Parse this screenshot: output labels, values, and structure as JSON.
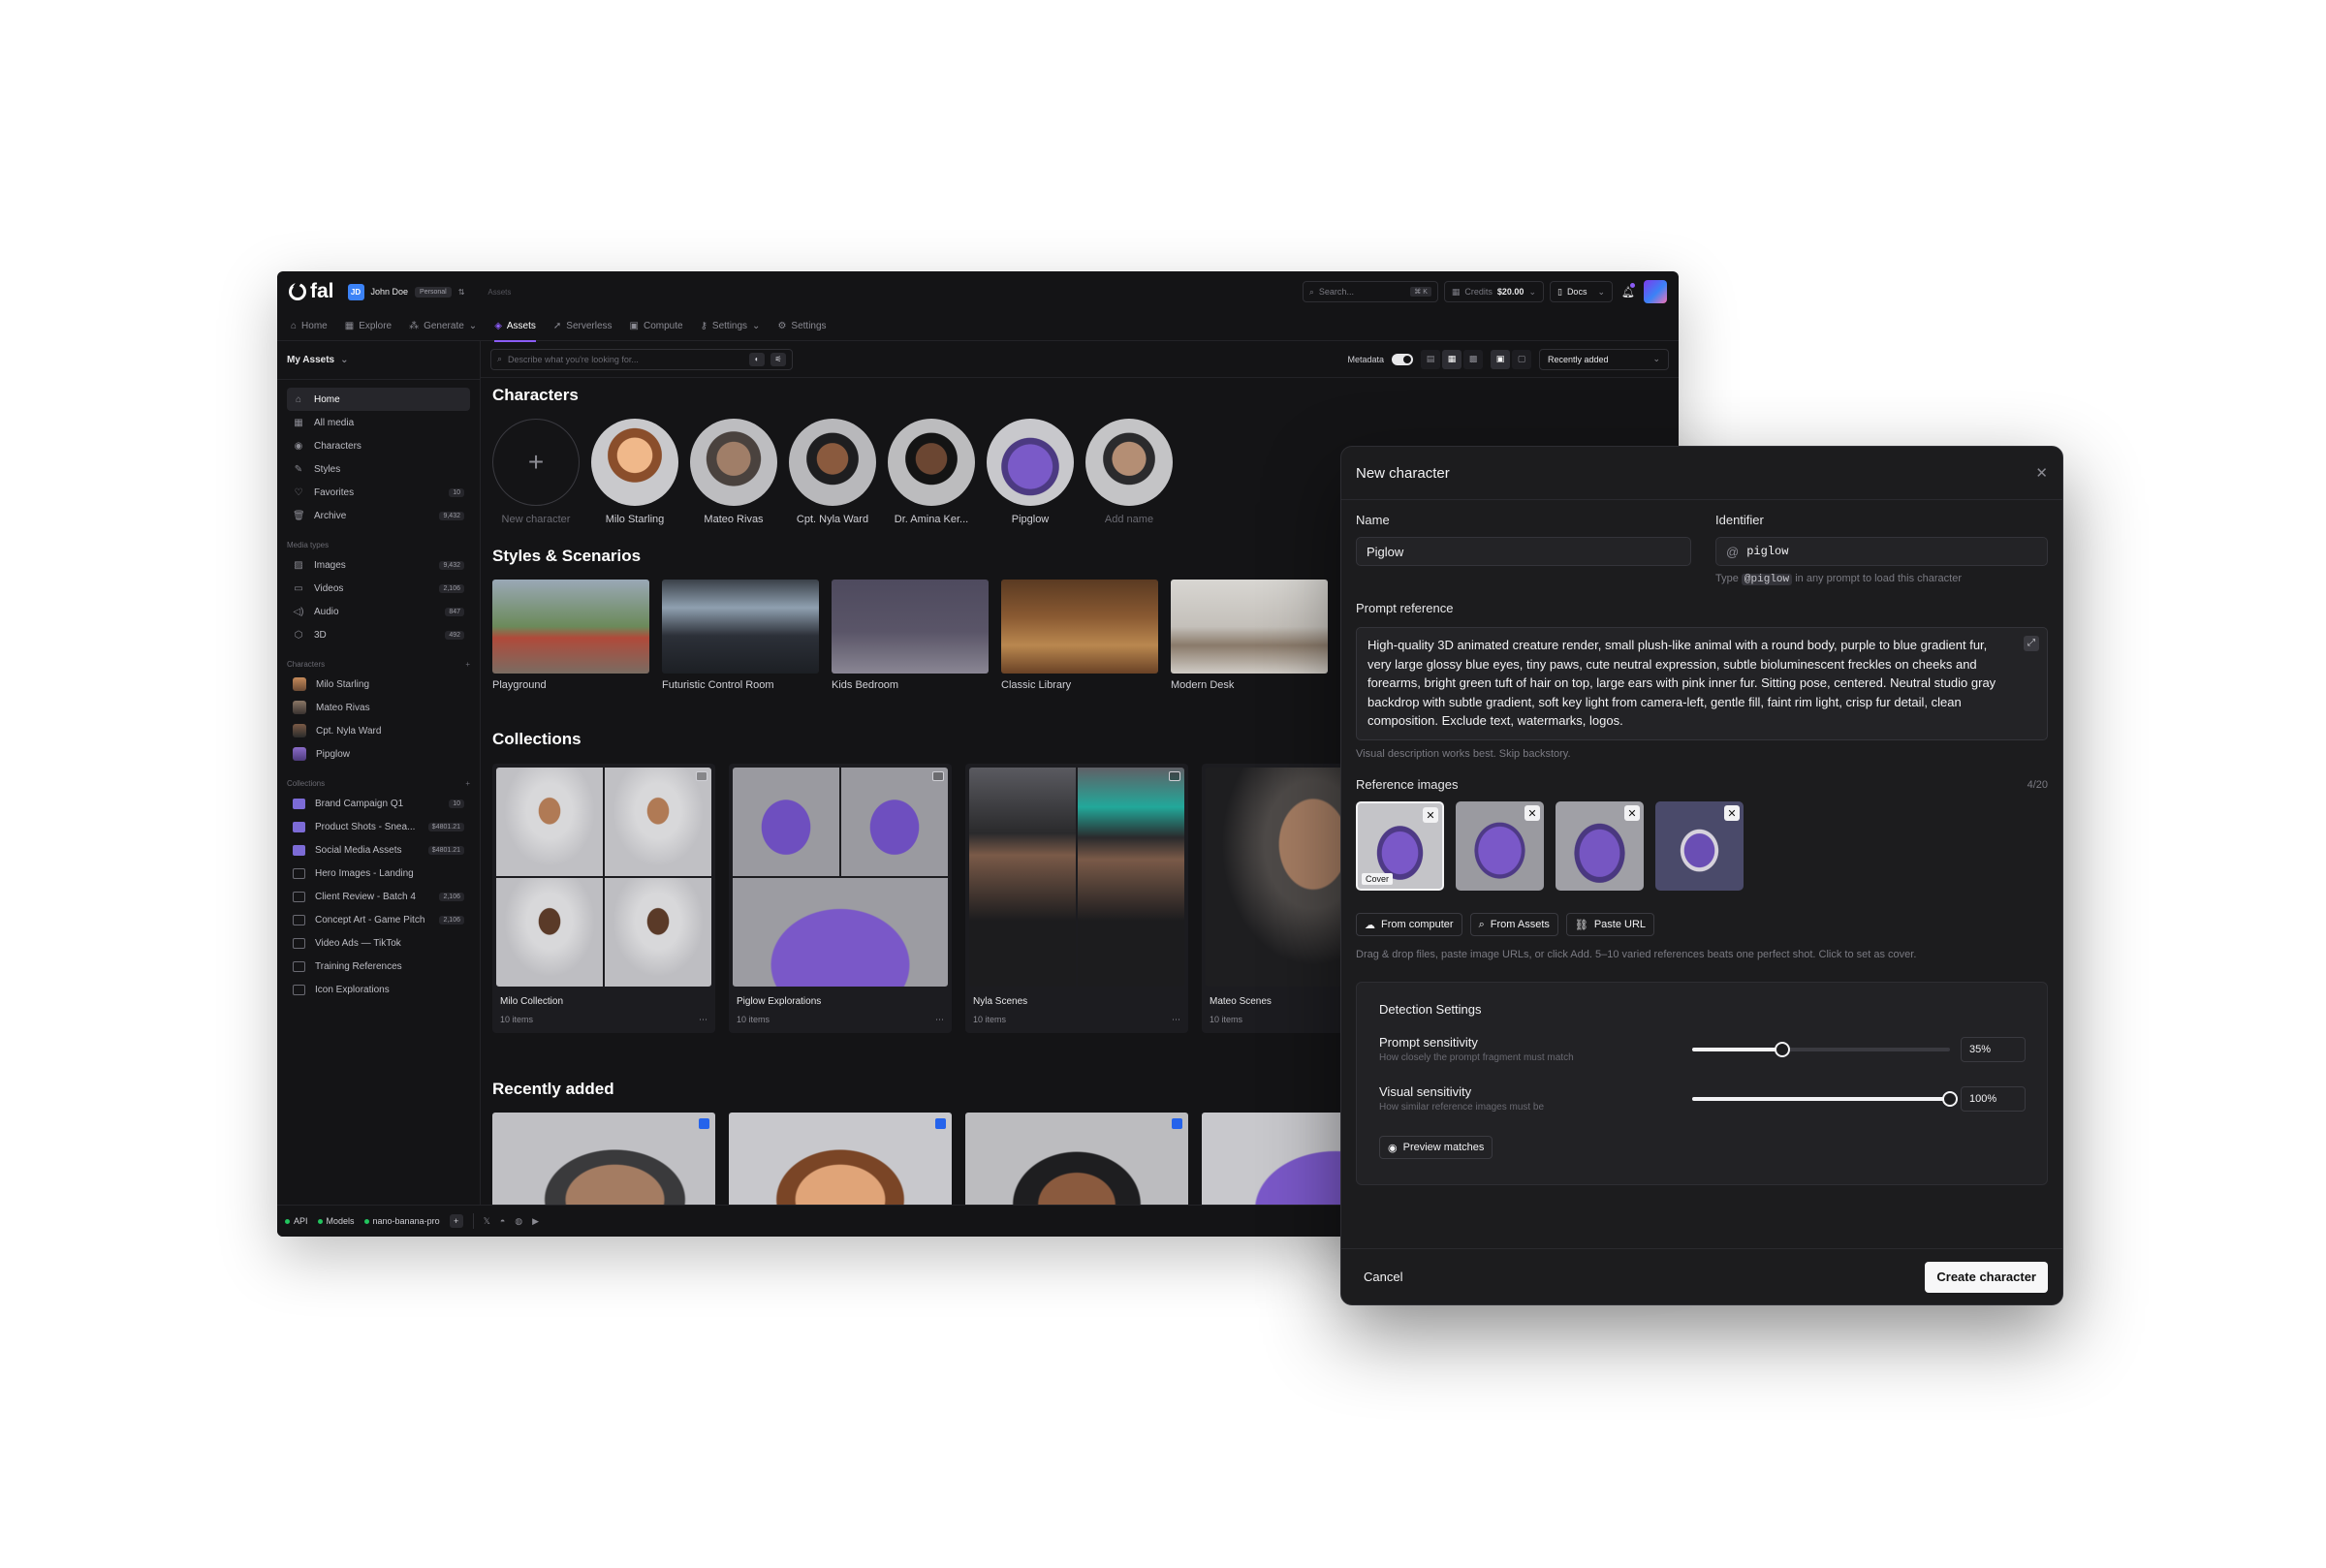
{
  "app": {
    "logo_text": "fal",
    "user": {
      "initials": "JD",
      "name": "John Doe",
      "plan": "Personal"
    },
    "breadcrumb": "Assets",
    "search": {
      "placeholder": "Search...",
      "shortcut": "⌘ K"
    },
    "credits": {
      "label": "Credits",
      "value": "$20.00"
    },
    "docs_label": "Docs",
    "colors": {
      "accent": "#8b5cf6",
      "background": "#141416",
      "badge_blue": "#2563eb"
    }
  },
  "nav": {
    "tabs": [
      {
        "label": "Home",
        "icon": "home-icon"
      },
      {
        "label": "Explore",
        "icon": "grid-icon"
      },
      {
        "label": "Generate",
        "icon": "sparkle-icon"
      },
      {
        "label": "Assets",
        "icon": "layers-icon",
        "active": true
      },
      {
        "label": "Serverless",
        "icon": "rocket-icon"
      },
      {
        "label": "Compute",
        "icon": "cpu-icon"
      },
      {
        "label": "Settings",
        "icon": "key-icon"
      },
      {
        "label": "Settings",
        "icon": "gear-icon"
      }
    ]
  },
  "sidebar": {
    "title": "My Assets",
    "items": [
      {
        "label": "Home",
        "active": true
      },
      {
        "label": "All media"
      },
      {
        "label": "Characters"
      },
      {
        "label": "Styles"
      },
      {
        "label": "Favorites",
        "count": "10"
      },
      {
        "label": "Archive",
        "count": "9,432"
      }
    ],
    "media_types_title": "Media types",
    "media_types": [
      {
        "label": "Images",
        "count": "9,432"
      },
      {
        "label": "Videos",
        "count": "2,106"
      },
      {
        "label": "Audio",
        "count": "847"
      },
      {
        "label": "3D",
        "count": "492"
      }
    ],
    "characters_title": "Characters",
    "characters": [
      {
        "label": "Milo Starling"
      },
      {
        "label": "Mateo Rivas"
      },
      {
        "label": "Cpt. Nyla Ward"
      },
      {
        "label": "Pipglow"
      }
    ],
    "collections_title": "Collections",
    "collections": [
      {
        "label": "Brand Campaign Q1",
        "count": "10"
      },
      {
        "label": "Product Shots - Snea...",
        "count": "$4801.21"
      },
      {
        "label": "Social Media Assets",
        "count": "$4801.21"
      },
      {
        "label": "Hero Images - Landing",
        "count": ""
      },
      {
        "label": "Client Review - Batch 4",
        "count": "2,106"
      },
      {
        "label": "Concept Art - Game Pitch",
        "count": "2,106"
      },
      {
        "label": "Video Ads — TikTok",
        "count": ""
      },
      {
        "label": "Training References",
        "count": ""
      },
      {
        "label": "Icon Explorations",
        "count": ""
      }
    ]
  },
  "toolbar": {
    "describe_placeholder": "Describe what you're looking for...",
    "metadata_label": "Metadata",
    "sort_label": "Recently added"
  },
  "main": {
    "characters_title": "Characters",
    "characters": [
      {
        "label": "New character"
      },
      {
        "label": "Milo Starling"
      },
      {
        "label": "Mateo Rivas"
      },
      {
        "label": "Cpt. Nyla Ward"
      },
      {
        "label": "Dr. Amina Ker..."
      },
      {
        "label": "Pipglow"
      },
      {
        "label": "Add name"
      }
    ],
    "styles_title": "Styles & Scenarios",
    "styles": [
      {
        "label": "Playground"
      },
      {
        "label": "Futuristic Control Room"
      },
      {
        "label": "Kids Bedroom"
      },
      {
        "label": "Classic Library"
      },
      {
        "label": "Modern Desk"
      }
    ],
    "collections_title": "Collections",
    "collections": [
      {
        "name": "Milo Collection",
        "count": "10 items"
      },
      {
        "name": "Piglow Explorations",
        "count": "10 items"
      },
      {
        "name": "Nyla Scenes",
        "count": "10 items"
      },
      {
        "name": "Mateo Scenes",
        "count": "10 items"
      }
    ],
    "recent_title": "Recently added"
  },
  "bottombar": {
    "api": "API",
    "models": "Models",
    "model_name": "nano-banana-pro"
  },
  "modal": {
    "title": "New character",
    "name_label": "Name",
    "name_value": "Piglow",
    "identifier_label": "Identifier",
    "identifier_prefix": "@",
    "identifier_value": "piglow",
    "identifier_hint_pre": "Type",
    "identifier_hint_code": "@piglow",
    "identifier_hint_post": "in any prompt to load this character",
    "prompt_label": "Prompt reference",
    "prompt_value": "High-quality 3D animated creature render, small plush-like animal with a round body, purple to blue gradient fur, very large glossy blue eyes, tiny paws, cute neutral expression, subtle bioluminescent freckles on cheeks and forearms, bright green tuft of hair on top, large ears with pink inner fur. Sitting pose, centered. Neutral studio gray backdrop with subtle gradient, soft key light from camera-left, gentle fill, faint rim light, crisp fur detail, clean composition. Exclude text, watermarks, logos.",
    "prompt_hint": "Visual description works best. Skip backstory.",
    "ref_label": "Reference images",
    "ref_count": "4/20",
    "cover_tag": "Cover",
    "btn_computer": "From computer",
    "btn_assets": "From Assets",
    "btn_url": "Paste URL",
    "ref_hint": "Drag & drop files, paste image URLs, or click Add. 5–10 varied references beats one perfect shot. Click to set as cover.",
    "detection_title": "Detection Settings",
    "prompt_sens_label": "Prompt sensitivity",
    "prompt_sens_hint": "How closely the prompt fragment must match",
    "prompt_sens_value": "35%",
    "prompt_sens_level": 0.35,
    "visual_sens_label": "Visual sensitivity",
    "visual_sens_hint": "How similar reference images must be",
    "visual_sens_value": "100%",
    "visual_sens_level": 1.0,
    "preview_label": "Preview matches",
    "cancel_label": "Cancel",
    "create_label": "Create character"
  }
}
